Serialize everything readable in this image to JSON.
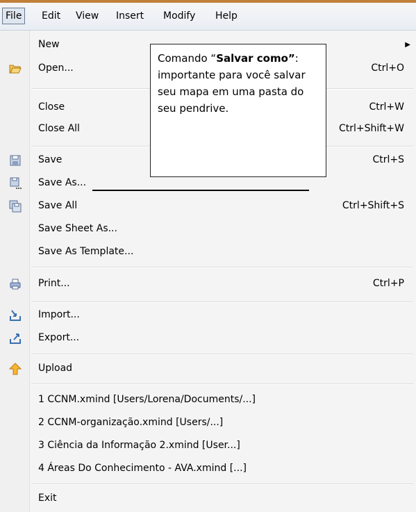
{
  "menubar": {
    "items": [
      "File",
      "Edit",
      "View",
      "Insert",
      "Modify",
      "Help"
    ],
    "active": "File"
  },
  "menu": {
    "items": [
      {
        "label": "New",
        "shortcut": "",
        "icon": "",
        "submenu": true
      },
      {
        "label": "Open...",
        "shortcut": "Ctrl+O",
        "icon": "folder-open-icon"
      },
      {
        "label": "Close",
        "shortcut": "Ctrl+W",
        "icon": ""
      },
      {
        "label": "Close All",
        "shortcut": "Ctrl+Shift+W",
        "icon": ""
      },
      {
        "label": "Save",
        "shortcut": "Ctrl+S",
        "icon": "save-icon"
      },
      {
        "label": "Save As...",
        "shortcut": "",
        "icon": "save-as-icon"
      },
      {
        "label": "Save All",
        "shortcut": "Ctrl+Shift+S",
        "icon": "save-all-icon"
      },
      {
        "label": "Save Sheet As...",
        "shortcut": "",
        "icon": ""
      },
      {
        "label": "Save As Template...",
        "shortcut": "",
        "icon": ""
      },
      {
        "label": "Print...",
        "shortcut": "Ctrl+P",
        "icon": "print-icon"
      },
      {
        "label": "Import...",
        "shortcut": "",
        "icon": "import-icon"
      },
      {
        "label": "Export...",
        "shortcut": "",
        "icon": "export-icon"
      },
      {
        "label": "Upload",
        "shortcut": "",
        "icon": "upload-arrow-icon"
      },
      {
        "label": "1 CCNM.xmind  [Users/Lorena/Documents/...]",
        "shortcut": "",
        "icon": ""
      },
      {
        "label": "2 CCNM-organização.xmind  [Users/...]",
        "shortcut": "",
        "icon": ""
      },
      {
        "label": "3 Ciência da Informação 2.xmind  [User...]",
        "shortcut": "",
        "icon": ""
      },
      {
        "label": "4 Áreas Do Conhecimento - AVA.xmind  [...]",
        "shortcut": "",
        "icon": ""
      },
      {
        "label": "Exit",
        "shortcut": "",
        "icon": ""
      }
    ]
  },
  "callout": {
    "part1": "Comando “",
    "bold": "Salvar como”",
    "part2": ": importante para você salvar seu mapa em uma pasta do seu pendrive."
  },
  "colors": {
    "menubar_top_border": "#c0803a",
    "folder_icon": "#e0a020",
    "upload_icon": "#f4a020",
    "disk_icon": "#7a8fb0"
  }
}
